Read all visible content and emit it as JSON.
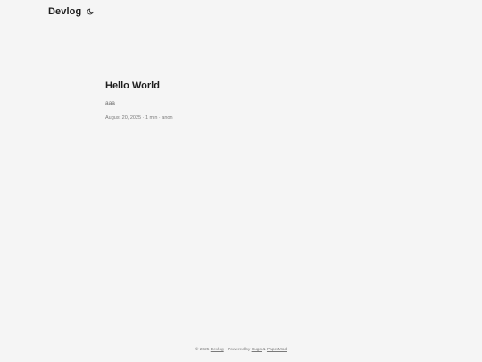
{
  "header": {
    "logo_text": "Devlog",
    "theme_toggle_icon": "moon-icon"
  },
  "post": {
    "title": "Hello World",
    "summary": "aaa",
    "meta": "August 20, 2025 · 1 min · anon"
  },
  "footer": {
    "copyright_prefix": "© 2025 ",
    "site_link": "Devlog",
    "powered_by_prefix": " · Powered by ",
    "hugo_link": "Hugo",
    "and_text": " & ",
    "theme_link": "PaperMod"
  }
}
